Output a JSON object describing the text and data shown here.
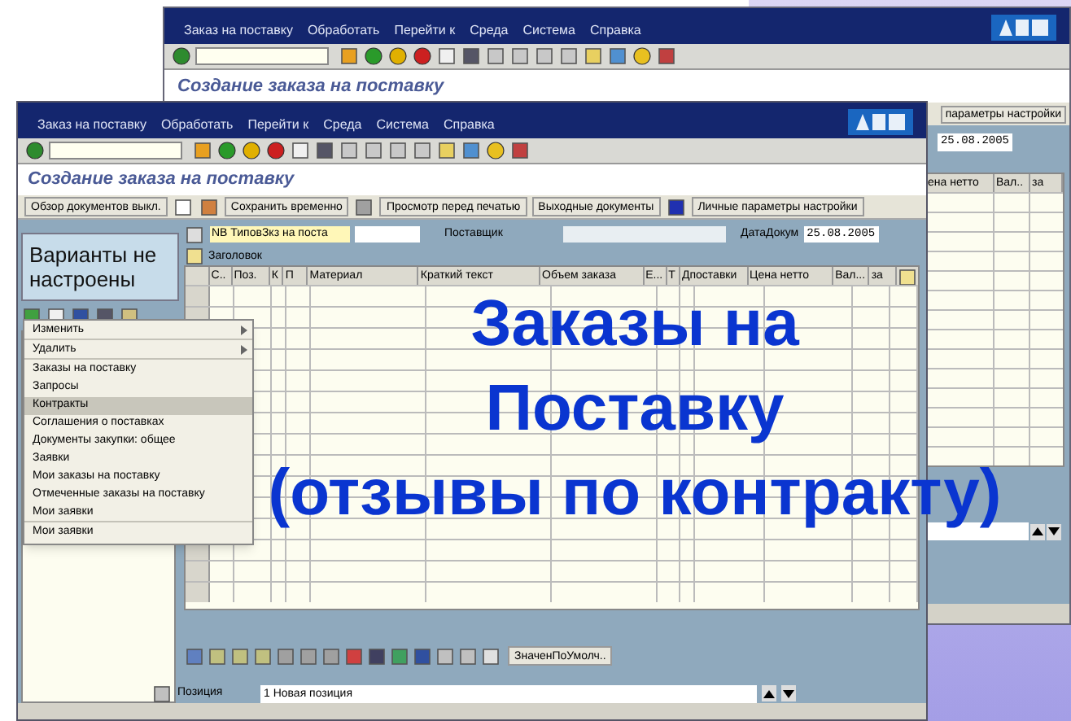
{
  "back_window": {
    "menu": [
      "Заказ на поставку",
      "Обработать",
      "Перейти к",
      "Среда",
      "Система",
      "Справка"
    ],
    "title": "Создание заказа на поставку",
    "toolbar_button": "параметры настройки",
    "date_value": "25.08.2005",
    "columns": [
      "ена нетто",
      "Вал..",
      "за"
    ]
  },
  "front_window": {
    "menu": [
      "Заказ на поставку",
      "Обработать",
      "Перейти к",
      "Среда",
      "Система",
      "Справка"
    ],
    "title": "Создание заказа на поставку",
    "app_toolbar": [
      "Обзор документов выкл.",
      "Сохранить временно",
      "Просмотр перед печатью",
      "Выходные документы",
      "Личные параметры настройки"
    ],
    "variants_text": "Варианты не настроены",
    "context_menu": [
      {
        "label": "Изменить",
        "submenu": true,
        "selected": false,
        "divider_after": true
      },
      {
        "label": "Удалить",
        "submenu": true,
        "selected": false,
        "divider_after": true
      },
      {
        "label": "Заказы на поставку",
        "submenu": false,
        "selected": false,
        "divider_after": false
      },
      {
        "label": "Запросы",
        "submenu": false,
        "selected": false,
        "divider_after": false
      },
      {
        "label": "Контракты",
        "submenu": false,
        "selected": true,
        "divider_after": false
      },
      {
        "label": "Соглашения о поставках",
        "submenu": false,
        "selected": false,
        "divider_after": false
      },
      {
        "label": "Документы закупки: общее",
        "submenu": false,
        "selected": false,
        "divider_after": false
      },
      {
        "label": "Заявки",
        "submenu": false,
        "selected": false,
        "divider_after": false
      },
      {
        "label": "Мои заказы на поставку",
        "submenu": false,
        "selected": false,
        "divider_after": false
      },
      {
        "label": "Отмеченные заказы на поставку",
        "submenu": false,
        "selected": false,
        "divider_after": false
      },
      {
        "label": "Мои заявки",
        "submenu": false,
        "selected": false,
        "divider_after": true
      },
      {
        "label": "Мои заявки",
        "submenu": false,
        "selected": false,
        "divider_after": false
      }
    ],
    "doc_type": "NB ТиповЗкз на поста",
    "vendor_label": "Поставщик",
    "date_label": "ДатаДокум",
    "date_value": "25.08.2005",
    "header_button": "Заголовок",
    "columns": [
      "С..",
      "Поз.",
      "К",
      "П",
      "Материал",
      "Краткий текст",
      "Объем заказа",
      "Е...",
      "Т",
      "Дпоставки",
      "Цена нетто",
      "Вал...",
      "за"
    ],
    "default_button": "ЗначенПоУмолч..",
    "position_label": "Позиция",
    "position_value": "1 Новая позиция"
  },
  "overlay_title": [
    "Заказы на",
    "Поставку",
    "(отзывы по контракту)"
  ]
}
